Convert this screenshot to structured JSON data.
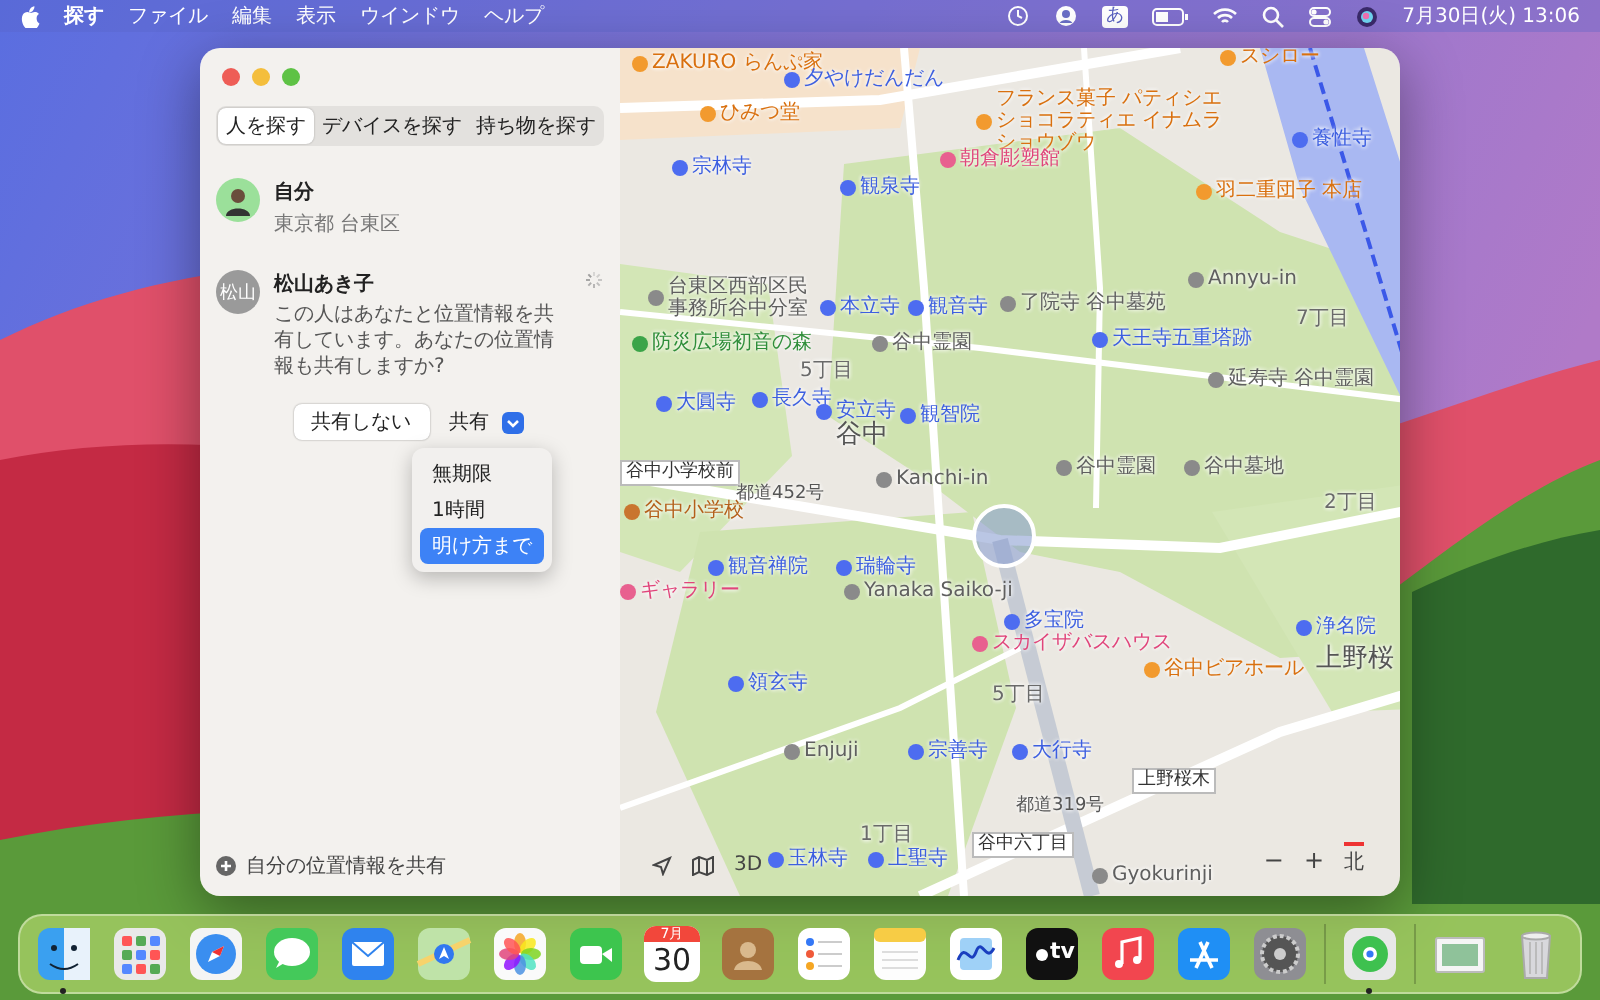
{
  "menu_bar": {
    "app_name": "探す",
    "menus": [
      "ファイル",
      "編集",
      "表示",
      "ウインドウ",
      "ヘルプ"
    ],
    "input_mode": "あ",
    "clock": "7月30日(火) 13:06"
  },
  "window": {
    "tabs": [
      {
        "label": "人を探す",
        "selected": true
      },
      {
        "label": "デバイスを探す",
        "selected": false
      },
      {
        "label": "持ち物を探す",
        "selected": false
      }
    ],
    "people": [
      {
        "kind": "me",
        "name": "自分",
        "detail": "東京都 台東区"
      },
      {
        "kind": "request",
        "name": "松山あき子",
        "avatar_text": "松山",
        "message": "この人はあなたと位置情報を共有しています。あなたの位置情報も共有しますか?",
        "decline": "共有しない",
        "accept": "共有",
        "loading": true
      }
    ],
    "duration_menu": [
      {
        "label": "無期限",
        "selected": false
      },
      {
        "label": "1時間",
        "selected": false
      },
      {
        "label": "明け方まで",
        "selected": true
      }
    ],
    "share_location": "自分の位置情報を共有"
  },
  "map": {
    "labels": [
      {
        "text": "ZAKURO らんぷ家",
        "kind": "food"
      },
      {
        "text": "夕やけだんだん",
        "kind": "landmark"
      },
      {
        "text": "ひみつ堂",
        "kind": "food"
      },
      {
        "text": "フランス菓子 パティシエショコラティエ イナムラショウゾウ",
        "kind": "food"
      },
      {
        "text": "スシロー",
        "kind": "food"
      },
      {
        "text": "朝倉彫塑館",
        "kind": "shop"
      },
      {
        "text": "養性寺",
        "kind": "temple"
      },
      {
        "text": "羽二重団子 本店",
        "kind": "food"
      },
      {
        "text": "宗林寺",
        "kind": "temple"
      },
      {
        "text": "観泉寺",
        "kind": "temple"
      },
      {
        "text": "台東区西部区民事務所谷中分室",
        "kind": "poi"
      },
      {
        "text": "本立寺",
        "kind": "temple"
      },
      {
        "text": "観音寺",
        "kind": "temple"
      },
      {
        "text": "了院寺 谷中墓苑",
        "kind": "poi"
      },
      {
        "text": "Annyu-in",
        "kind": "poi"
      },
      {
        "text": "防災広場初音の森",
        "kind": "park"
      },
      {
        "text": "谷中霊園",
        "kind": "poi"
      },
      {
        "text": "天王寺五重塔跡",
        "kind": "landmark"
      },
      {
        "text": "7丁目",
        "kind": "area"
      },
      {
        "text": "5丁目",
        "kind": "area"
      },
      {
        "text": "延寿寺 谷中霊園",
        "kind": "poi"
      },
      {
        "text": "大圓寺",
        "kind": "temple"
      },
      {
        "text": "長久寺",
        "kind": "temple"
      },
      {
        "text": "安立寺",
        "kind": "temple"
      },
      {
        "text": "観智院",
        "kind": "temple"
      },
      {
        "text": "谷中",
        "kind": "district"
      },
      {
        "text": "谷中小学校前",
        "kind": "station"
      },
      {
        "text": "都道452号",
        "kind": "road"
      },
      {
        "text": "谷中小学校",
        "kind": "school"
      },
      {
        "text": "Kanchi-in",
        "kind": "poi"
      },
      {
        "text": "谷中霊園",
        "kind": "poi"
      },
      {
        "text": "谷中墓地",
        "kind": "poi"
      },
      {
        "text": "2丁目",
        "kind": "area"
      },
      {
        "text": "観音禅院",
        "kind": "temple"
      },
      {
        "text": "瑞輪寺",
        "kind": "temple"
      },
      {
        "text": "ギャラリー",
        "kind": "shop"
      },
      {
        "text": "Yanaka Saiko-ji",
        "kind": "poi"
      },
      {
        "text": "多宝院",
        "kind": "temple"
      },
      {
        "text": "スカイザバスハウス",
        "kind": "shop"
      },
      {
        "text": "谷中ビアホール",
        "kind": "food"
      },
      {
        "text": "浄名院",
        "kind": "temple"
      },
      {
        "text": "上野桜",
        "kind": "district"
      },
      {
        "text": "5丁目",
        "kind": "area"
      },
      {
        "text": "領玄寺",
        "kind": "temple"
      },
      {
        "text": "Enjuji",
        "kind": "poi"
      },
      {
        "text": "宗善寺",
        "kind": "temple"
      },
      {
        "text": "大行寺",
        "kind": "temple"
      },
      {
        "text": "上野桜木",
        "kind": "station"
      },
      {
        "text": "都道319号",
        "kind": "road"
      },
      {
        "text": "1丁目",
        "kind": "area"
      },
      {
        "text": "谷中六丁目",
        "kind": "station"
      },
      {
        "text": "玉林寺",
        "kind": "temple"
      },
      {
        "text": "上聖寺",
        "kind": "temple"
      },
      {
        "text": "Gyokurinji",
        "kind": "poi"
      }
    ],
    "view_button": "3D",
    "zoom_out": "−",
    "zoom_in": "+",
    "compass": "北"
  },
  "dock": [
    {
      "kind": "finder",
      "running": true
    },
    {
      "kind": "launchpad",
      "running": false
    },
    {
      "kind": "safari",
      "running": false
    },
    {
      "kind": "messages",
      "running": false
    },
    {
      "kind": "mail",
      "running": false
    },
    {
      "kind": "maps",
      "running": false
    },
    {
      "kind": "photos",
      "running": false
    },
    {
      "kind": "facetime",
      "running": false
    },
    {
      "kind": "calendar",
      "running": false,
      "month": "7月",
      "day": "30"
    },
    {
      "kind": "contacts",
      "running": false
    },
    {
      "kind": "reminders",
      "running": false
    },
    {
      "kind": "notes",
      "running": false
    },
    {
      "kind": "freeform",
      "running": false
    },
    {
      "kind": "tv",
      "running": false,
      "label": "tv"
    },
    {
      "kind": "music",
      "running": false
    },
    {
      "kind": "appstore",
      "running": false
    },
    {
      "kind": "settings",
      "running": false
    },
    {
      "kind": "separator"
    },
    {
      "kind": "findmy",
      "running": true
    },
    {
      "kind": "separator"
    },
    {
      "kind": "preview",
      "running": false
    },
    {
      "kind": "trash",
      "running": false
    }
  ]
}
